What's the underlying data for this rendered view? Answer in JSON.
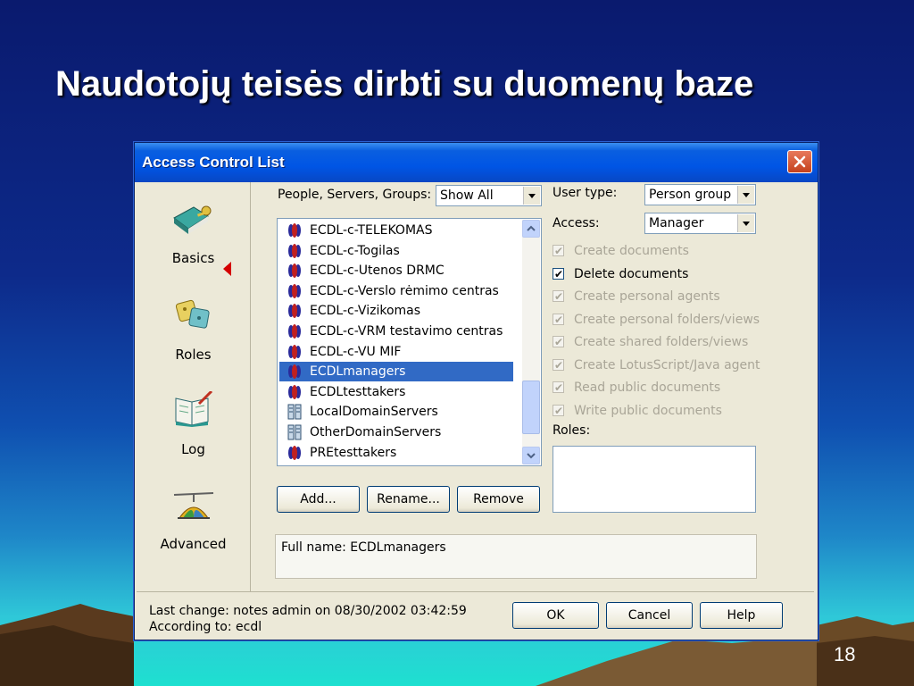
{
  "slide": {
    "title": "Naudotojų teisės dirbti su duomenų baze",
    "page_number": "18"
  },
  "window": {
    "title": "Access Control List",
    "close_icon": "close-icon"
  },
  "nav": [
    {
      "label": "Basics",
      "icon": "book-key-icon",
      "active": true
    },
    {
      "label": "Roles",
      "icon": "roles-icon",
      "active": false
    },
    {
      "label": "Log",
      "icon": "log-icon",
      "active": false
    },
    {
      "label": "Advanced",
      "icon": "advanced-icon",
      "active": false
    }
  ],
  "filter": {
    "label": "People, Servers, Groups:",
    "value": "Show All"
  },
  "list": [
    {
      "label": "ECDL-c-TELEKOMAS",
      "icon": "group-icon",
      "selected": false
    },
    {
      "label": "ECDL-c-Togilas",
      "icon": "group-icon",
      "selected": false
    },
    {
      "label": "ECDL-c-Utenos DRMC",
      "icon": "group-icon",
      "selected": false
    },
    {
      "label": "ECDL-c-Verslo rėmimo centras",
      "icon": "group-icon",
      "selected": false
    },
    {
      "label": "ECDL-c-Vizikomas",
      "icon": "group-icon",
      "selected": false
    },
    {
      "label": "ECDL-c-VRM testavimo centras",
      "icon": "group-icon",
      "selected": false
    },
    {
      "label": "ECDL-c-VU MIF",
      "icon": "group-icon",
      "selected": false
    },
    {
      "label": "ECDLmanagers",
      "icon": "group-icon",
      "selected": true
    },
    {
      "label": "ECDLtesttakers",
      "icon": "group-icon",
      "selected": false
    },
    {
      "label": "LocalDomainServers",
      "icon": "server-icon",
      "selected": false
    },
    {
      "label": "OtherDomainServers",
      "icon": "server-icon",
      "selected": false
    },
    {
      "label": "PREtesttakers",
      "icon": "group-icon",
      "selected": false
    }
  ],
  "list_buttons": {
    "add": "Add...",
    "rename": "Rename...",
    "remove": "Remove"
  },
  "user_type": {
    "label": "User type:",
    "value": "Person group"
  },
  "access": {
    "label": "Access:",
    "value": "Manager"
  },
  "permissions": [
    {
      "label": "Create documents",
      "checked": true,
      "enabled": false
    },
    {
      "label": "Delete documents",
      "checked": true,
      "enabled": true
    },
    {
      "label": "Create personal agents",
      "checked": true,
      "enabled": false
    },
    {
      "label": "Create personal folders/views",
      "checked": true,
      "enabled": false
    },
    {
      "label": "Create shared folders/views",
      "checked": true,
      "enabled": false
    },
    {
      "label": "Create LotusScript/Java agent",
      "checked": true,
      "enabled": false
    },
    {
      "label": "Read public documents",
      "checked": true,
      "enabled": false
    },
    {
      "label": "Write public documents",
      "checked": true,
      "enabled": false
    }
  ],
  "roles": {
    "label": "Roles:"
  },
  "full_name": "Full name: ECDLmanagers",
  "status": {
    "last_change": "Last change: notes admin on 08/30/2002 03:42:59",
    "according_to": "According to: ecdl"
  },
  "dialog_buttons": {
    "ok": "OK",
    "cancel": "Cancel",
    "help": "Help"
  },
  "colors": {
    "selection": "#316ac5",
    "titlebar": "#0055e5",
    "arrow": "#d40000"
  }
}
